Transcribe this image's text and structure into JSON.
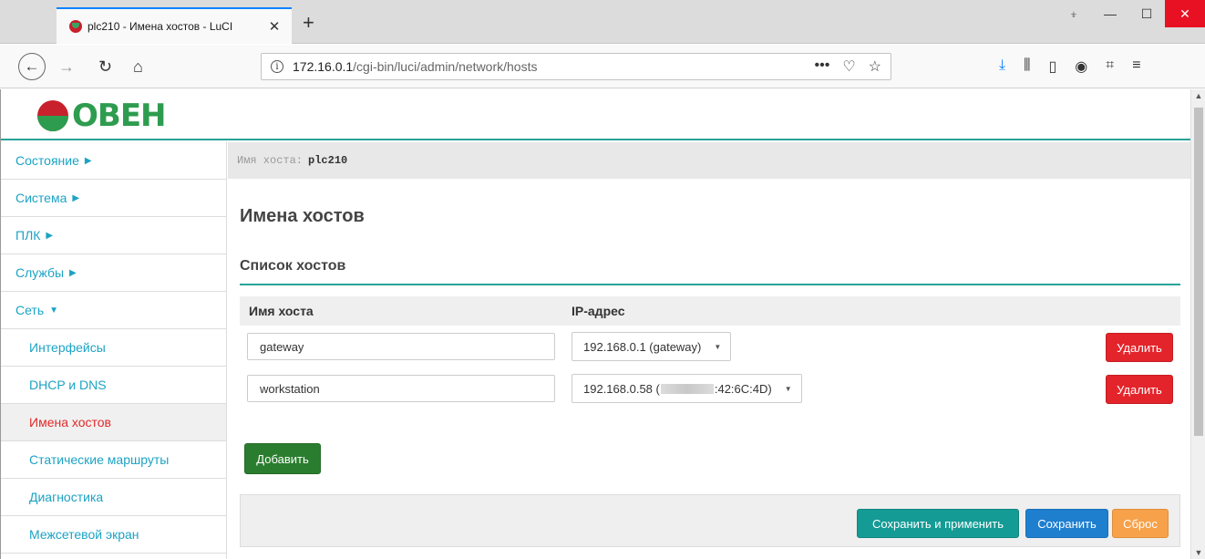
{
  "browser": {
    "tab_title": "plc210 - Имена хостов - LuCI",
    "tab_close": "✕",
    "new_tab": "+",
    "url_host": "172.16.0.1",
    "url_path": "/cgi-bin/luci/admin/network/hosts",
    "window_controls": {
      "pin": "⍖",
      "minimize": "—",
      "maximize": "☐",
      "close": "✕"
    }
  },
  "logo": {
    "text": "ОВЕН"
  },
  "sidebar": {
    "items": [
      {
        "label": "Состояние",
        "arrow": "▶"
      },
      {
        "label": "Система",
        "arrow": "▶"
      },
      {
        "label": "ПЛК",
        "arrow": "▶"
      },
      {
        "label": "Службы",
        "arrow": "▶"
      },
      {
        "label": "Сеть",
        "arrow": "▼"
      },
      {
        "label": "Интерфейсы"
      },
      {
        "label": "DHCP и DNS"
      },
      {
        "label": "Имена хостов"
      },
      {
        "label": "Статические маршруты"
      },
      {
        "label": "Диагностика"
      },
      {
        "label": "Межсетевой экран"
      }
    ]
  },
  "hostbar": {
    "label": "Имя хоста:",
    "value": "plc210"
  },
  "main": {
    "title": "Имена хостов",
    "section_title": "Список хостов",
    "columns": {
      "host": "Имя хоста",
      "ip": "IP-адрес"
    },
    "rows": [
      {
        "host": "gateway",
        "ip": "192.168.0.1 (gateway)",
        "delete_label": "Удалить"
      },
      {
        "host": "workstation",
        "ip_prefix": "192.168.0.58 (",
        "ip_suffix": ":42:6C:4D)",
        "delete_label": "Удалить"
      }
    ],
    "add_label": "Добавить"
  },
  "footer": {
    "apply_label": "Сохранить и применить",
    "save_label": "Сохранить",
    "reset_label": "Сброс"
  },
  "colors": {
    "accent": "#29a39a",
    "link": "#1ca3c4",
    "active": "#e02a2a",
    "delete": "#e3242b",
    "add": "#2a7d2e",
    "apply": "#149b95",
    "save": "#1f7fcf",
    "reset": "#f7a14a"
  }
}
